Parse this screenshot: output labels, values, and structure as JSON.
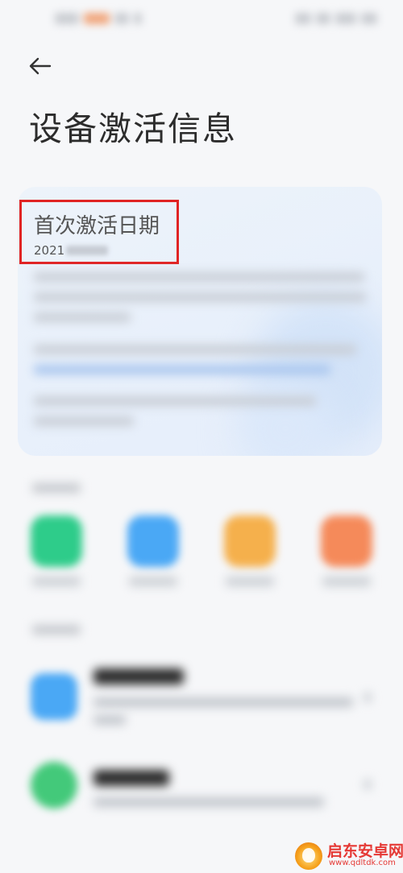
{
  "header": {
    "back_icon": "back-arrow-icon",
    "title": "设备激活信息"
  },
  "activation": {
    "label": "首次激活日期",
    "date_visible": "2021"
  },
  "colors": {
    "highlight_border": "#e02424",
    "card_bg": "#e8f0fb",
    "link_text": "#a9c6ee",
    "app1": "#2ecc8a",
    "app2": "#4aa8f5",
    "app3": "#f5b04c",
    "app4": "#f58a5a",
    "cloud_service": "#4aa8f5",
    "device_item": "#43c97a",
    "watermark": "#e53935"
  },
  "watermark": {
    "title": "启东安卓网",
    "url": "www.qdltdk.com"
  }
}
